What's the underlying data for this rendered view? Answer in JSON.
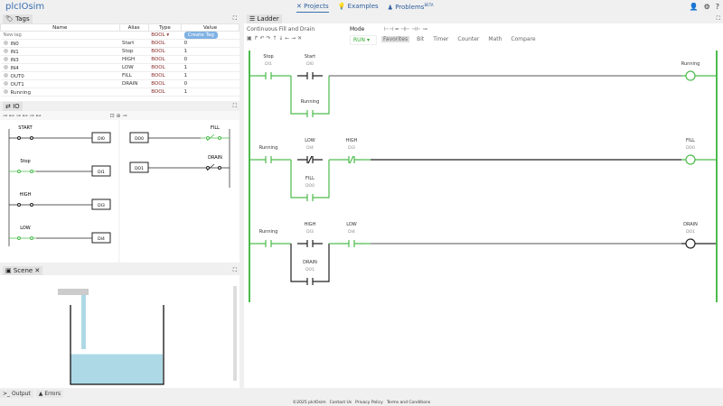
{
  "app": {
    "logo": "plcIOsim"
  },
  "nav": {
    "projects": "Projects",
    "examples": "Examples",
    "problems": "Problems",
    "beta": "BETA"
  },
  "tags": {
    "title": "Tags",
    "headers": [
      "Name",
      "Alias",
      "Type",
      "Value"
    ],
    "new_tag_placeholder": "New tag",
    "new_type": "BOOL",
    "create": "Create Tag",
    "rows": [
      {
        "name": "IN0",
        "alias": "Start",
        "type": "BOOL",
        "value": "0"
      },
      {
        "name": "IN1",
        "alias": "Stop",
        "type": "BOOL",
        "value": "1"
      },
      {
        "name": "IN3",
        "alias": "HIGH",
        "type": "BOOL",
        "value": "0"
      },
      {
        "name": "IN4",
        "alias": "LOW",
        "type": "BOOL",
        "value": "1"
      },
      {
        "name": "OUT0",
        "alias": "FILL",
        "type": "BOOL",
        "value": "1"
      },
      {
        "name": "OUT1",
        "alias": "DRAIN",
        "type": "BOOL",
        "value": "0"
      },
      {
        "name": "Running",
        "alias": "",
        "type": "BOOL",
        "value": "1"
      }
    ]
  },
  "io": {
    "title": "IO",
    "inputs": [
      {
        "label": "START",
        "addr": "DI0"
      },
      {
        "label": "Stop",
        "addr": "DI1"
      },
      {
        "label": "HIGH",
        "addr": "DI3"
      },
      {
        "label": "LOW",
        "addr": "DI4"
      }
    ],
    "outputs": [
      {
        "label": "FILL",
        "addr": "DO0"
      },
      {
        "label": "DRAIN",
        "addr": "DO1"
      }
    ]
  },
  "scene": {
    "title": "Scene",
    "water_level": 0.38
  },
  "bottom": {
    "output": "Output",
    "errors": "Errors"
  },
  "ladder": {
    "title": "Ladder",
    "program": "Continuous Fill and Drain",
    "mode_label": "Mode",
    "mode": "RUN",
    "instr_tabs": [
      "Favorites",
      "Bit",
      "Timer",
      "Counter",
      "Math",
      "Compare"
    ],
    "rungs": [
      {
        "c1": {
          "label": "Stop",
          "addr": "DI1"
        },
        "c2": {
          "label": "Start",
          "addr": "DI0"
        },
        "branch": {
          "label": "Running",
          "addr": ""
        },
        "coil": {
          "label": "Running",
          "addr": ""
        }
      },
      {
        "c1": {
          "label": "Running",
          "addr": ""
        },
        "c2": {
          "label": "LOW",
          "addr": "DI4"
        },
        "branch": {
          "label": "FILL",
          "addr": "DO0"
        },
        "c3": {
          "label": "HIGH",
          "addr": "DI3"
        },
        "coil": {
          "label": "FILL",
          "addr": "DO0"
        }
      },
      {
        "c1": {
          "label": "Running",
          "addr": ""
        },
        "c2": {
          "label": "HIGH",
          "addr": "DI3"
        },
        "branch": {
          "label": "DRAIN",
          "addr": "DO1"
        },
        "c3": {
          "label": "LOW",
          "addr": "DI4"
        },
        "coil": {
          "label": "DRAIN",
          "addr": "DO1"
        }
      }
    ]
  },
  "colors": {
    "energized": "#4cbb4c",
    "accent": "#3a6fb0",
    "water": "#add8e6"
  },
  "footer": {
    "copyright": "©2025 plcIOsim",
    "contact": "Contact Us",
    "privacy": "Privacy Policy",
    "terms": "Terms and Conditions"
  }
}
